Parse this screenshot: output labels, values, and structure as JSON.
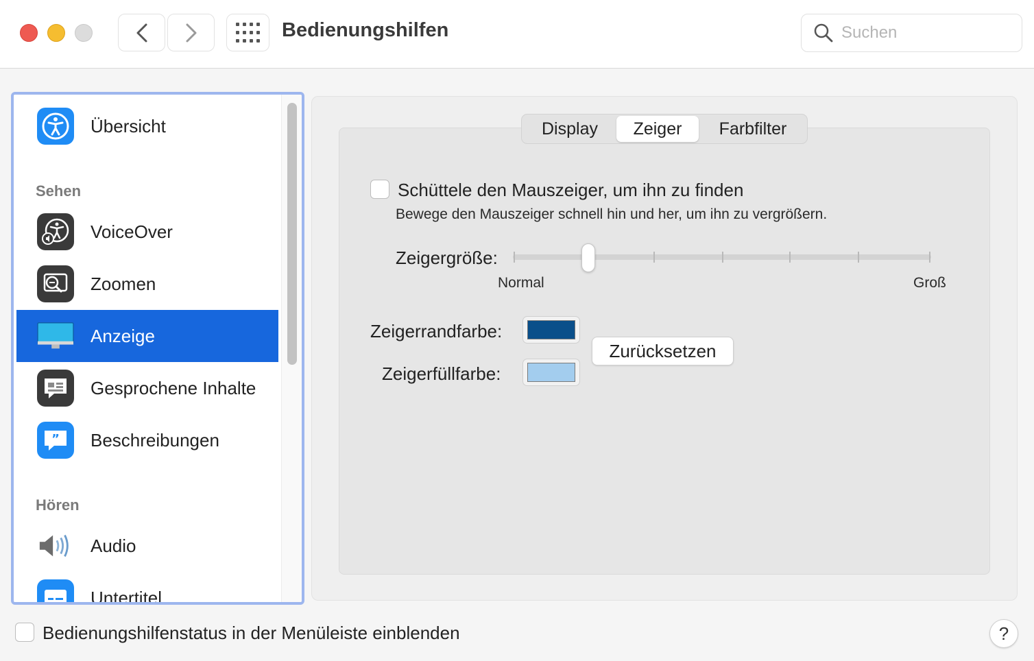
{
  "window": {
    "title": "Bedienungshilfen",
    "search_placeholder": "Suchen"
  },
  "sidebar": {
    "items": [
      {
        "label": "Übersicht",
        "icon": "accessibility-icon"
      },
      {
        "section": "Sehen"
      },
      {
        "label": "VoiceOver",
        "icon": "voiceover-icon"
      },
      {
        "label": "Zoomen",
        "icon": "zoom-icon"
      },
      {
        "label": "Anzeige",
        "icon": "display-icon",
        "selected": true
      },
      {
        "label": "Gesprochene Inhalte",
        "icon": "spoken-content-icon"
      },
      {
        "label": "Beschreibungen",
        "icon": "descriptions-icon"
      },
      {
        "section": "Hören"
      },
      {
        "label": "Audio",
        "icon": "speaker-icon"
      },
      {
        "label": "Untertitel",
        "icon": "captions-icon"
      }
    ]
  },
  "tabs": {
    "items": [
      "Display",
      "Zeiger",
      "Farbfilter"
    ],
    "selected": "Zeiger"
  },
  "pointer": {
    "shake_label": "Schüttele den Mauszeiger, um ihn zu finden",
    "shake_checked": false,
    "shake_desc": "Bewege den Mauszeiger schnell hin und her, um ihn zu vergrößern.",
    "size_label": "Zeigergröße:",
    "size_min_label": "Normal",
    "size_max_label": "Groß",
    "size_value_fraction": 0.18,
    "outline_label": "Zeigerrandfarbe:",
    "outline_color": "#0a4f8a",
    "fill_label": "Zeigerfüllfarbe:",
    "fill_color": "#a3cdee",
    "reset_label": "Zurücksetzen"
  },
  "footer": {
    "menubar_label": "Bedienungshilfenstatus in der Menüleiste einblenden",
    "menubar_checked": false,
    "help_label": "?"
  },
  "colors": {
    "selection": "#1767dd",
    "sidebar_focus_ring": "#9db6ee"
  }
}
